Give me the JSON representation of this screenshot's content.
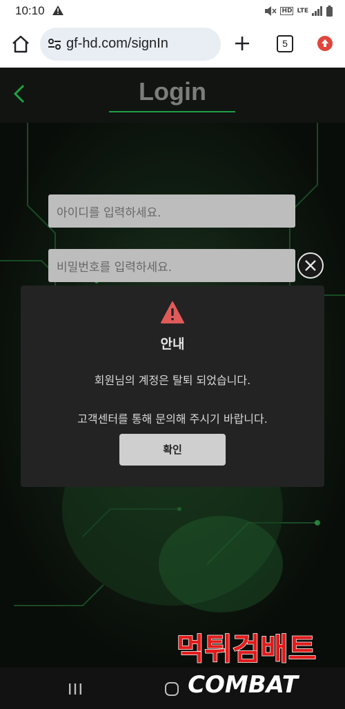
{
  "status_bar": {
    "time": "10:10",
    "network": "LTE",
    "hd_label": "HD"
  },
  "browser": {
    "url": "gf-hd.com/signIn",
    "tab_count": "5"
  },
  "page": {
    "title": "Login",
    "id_placeholder": "아이디를 입력하세요.",
    "password_placeholder": "비밀번호를 입력하세요."
  },
  "dialog": {
    "title": "안내",
    "message_line1": "회원님의 계정은 탈퇴 되었습니다.",
    "message_line2": "고객센터를 통해 문의해 주시기 바랍니다.",
    "confirm_label": "확인"
  },
  "watermark": {
    "line1": "먹튀검배트",
    "line2": "COMBAT"
  },
  "colors": {
    "accent_green": "#1ea043",
    "warning_red": "#e05a5a",
    "watermark_red": "#e21b1b"
  }
}
